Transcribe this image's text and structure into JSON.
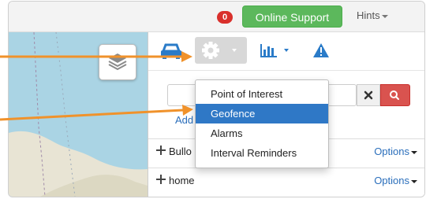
{
  "topbar": {
    "notification_count": "0",
    "support_label": "Online Support",
    "hints_label": "Hints"
  },
  "map": {
    "layers_icon": "layers-icon"
  },
  "toolbar": {
    "icons": [
      "car-icon",
      "gear-icon",
      "bar-chart-icon",
      "warning-icon"
    ]
  },
  "search": {
    "placeholder": "",
    "value": "",
    "add_label": "Add"
  },
  "list": {
    "rows": [
      {
        "name": "Bullo",
        "options_label": "Options"
      },
      {
        "name": "home",
        "options_label": "Options"
      }
    ]
  },
  "menu": {
    "items": [
      "Point of Interest",
      "Geofence",
      "Alarms",
      "Interval Reminders"
    ],
    "selected": "Geofence"
  },
  "colors": {
    "accent_orange": "#f0922b",
    "menu_highlight": "#2f78c6",
    "support_green": "#5cb85c",
    "badge_red": "#d9302c",
    "icon_blue": "#2a7bc8"
  }
}
